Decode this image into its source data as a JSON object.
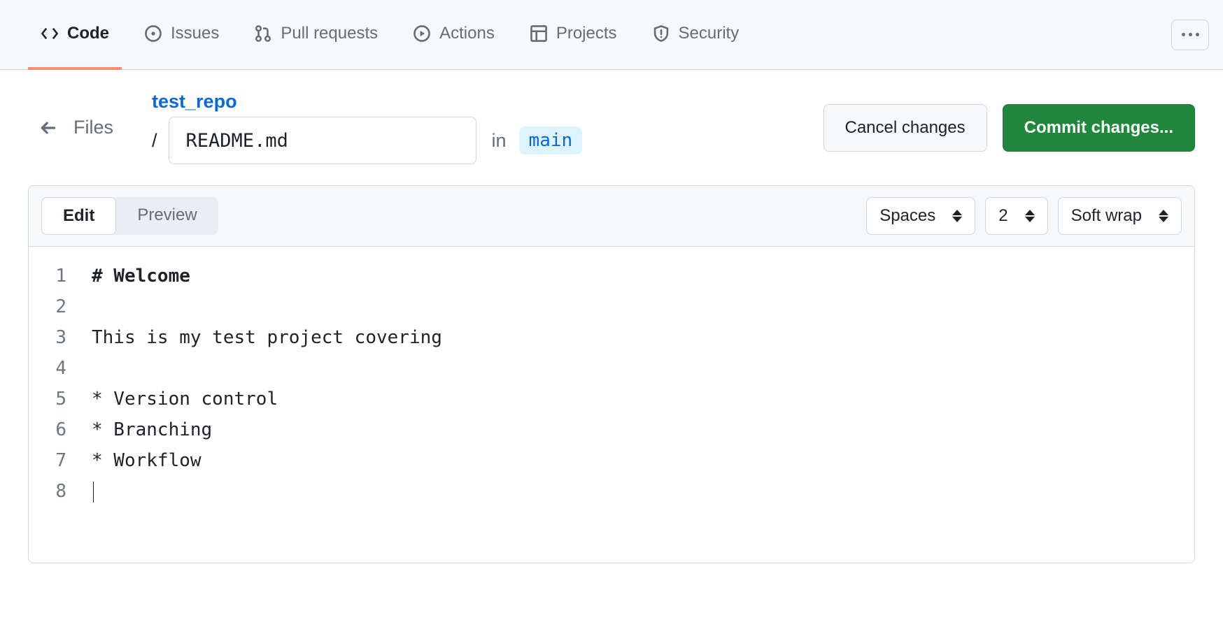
{
  "nav": {
    "tabs": [
      {
        "label": "Code",
        "icon": "code"
      },
      {
        "label": "Issues",
        "icon": "issue"
      },
      {
        "label": "Pull requests",
        "icon": "pr"
      },
      {
        "label": "Actions",
        "icon": "actions"
      },
      {
        "label": "Projects",
        "icon": "projects"
      },
      {
        "label": "Security",
        "icon": "security"
      }
    ]
  },
  "header": {
    "files_label": "Files",
    "repo_name": "test_repo",
    "filename_value": "README.md",
    "in_label": "in",
    "branch": "main",
    "cancel_label": "Cancel changes",
    "commit_label": "Commit changes..."
  },
  "editor_toolbar": {
    "edit_tab": "Edit",
    "preview_tab": "Preview",
    "indent_mode": "Spaces",
    "indent_size": "2",
    "wrap_mode": "Soft wrap"
  },
  "code": {
    "lines": [
      {
        "num": "1",
        "text": "# Welcome",
        "bold": true
      },
      {
        "num": "2",
        "text": ""
      },
      {
        "num": "3",
        "text": "This is my test project covering"
      },
      {
        "num": "4",
        "text": ""
      },
      {
        "num": "5",
        "text": "* Version control"
      },
      {
        "num": "6",
        "text": "* Branching"
      },
      {
        "num": "7",
        "text": "* Workflow"
      },
      {
        "num": "8",
        "text": "",
        "cursor": true
      }
    ]
  }
}
